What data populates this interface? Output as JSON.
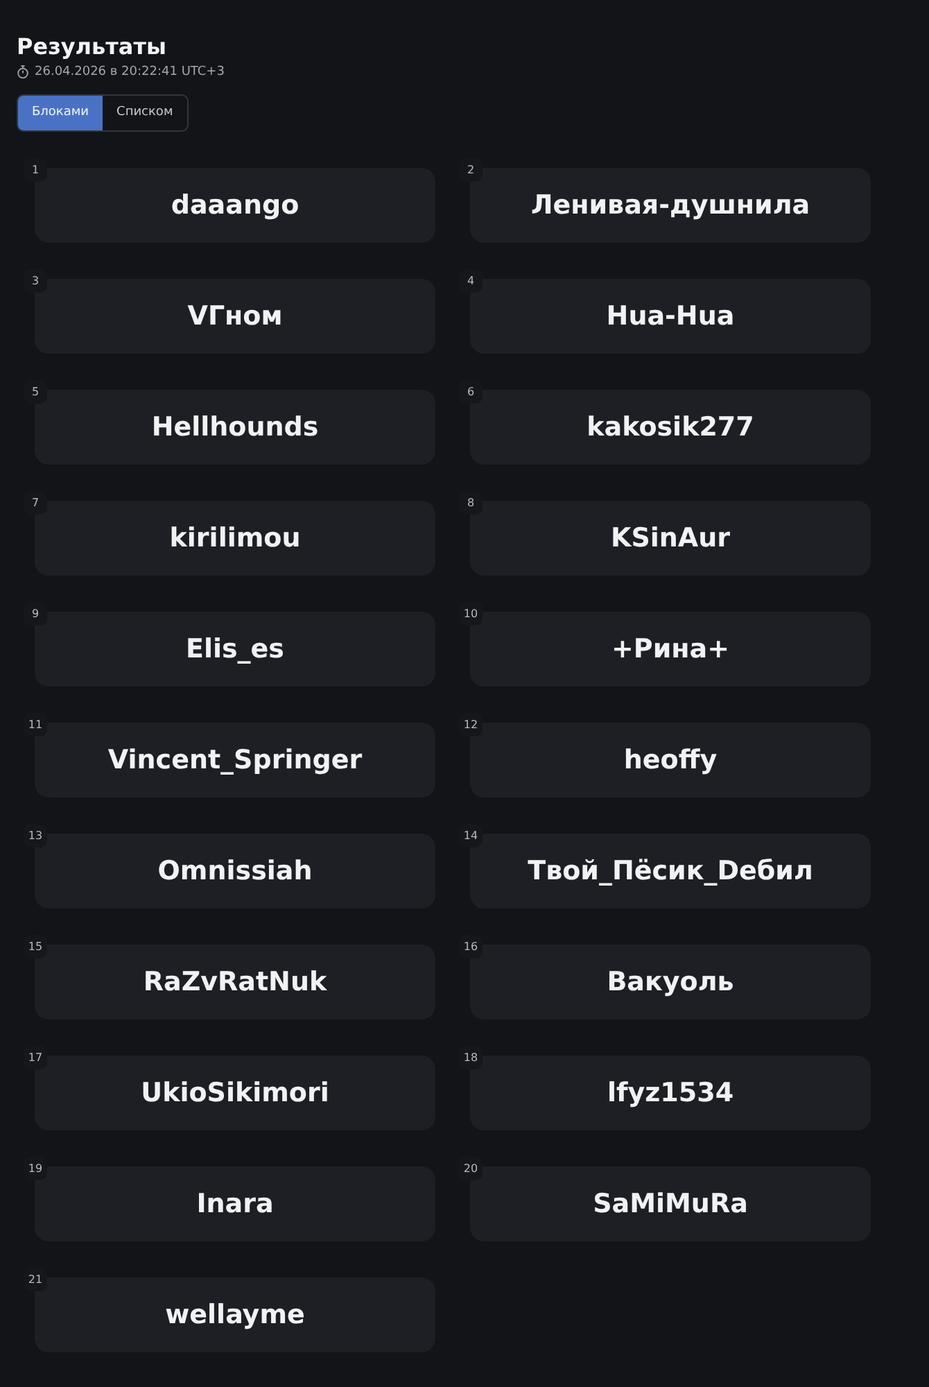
{
  "title": "Результаты",
  "timestamp": "26.04.2026 в 20:22:41 UTC+3",
  "view_toggle": [
    {
      "label": "Блоками",
      "selected": true
    },
    {
      "label": "Списком",
      "selected": false
    }
  ],
  "results": [
    {
      "rank": "1",
      "name": "daaango"
    },
    {
      "rank": "2",
      "name": "Ленивая-душнила"
    },
    {
      "rank": "3",
      "name": "VГном"
    },
    {
      "rank": "4",
      "name": "Hua-Hua"
    },
    {
      "rank": "5",
      "name": "Hellhounds"
    },
    {
      "rank": "6",
      "name": "kakosik277"
    },
    {
      "rank": "7",
      "name": "kirilimou"
    },
    {
      "rank": "8",
      "name": "KSinAur"
    },
    {
      "rank": "9",
      "name": "Elis_es"
    },
    {
      "rank": "10",
      "name": "+Рина+"
    },
    {
      "rank": "11",
      "name": "Vincent_Springer"
    },
    {
      "rank": "12",
      "name": "heoffy"
    },
    {
      "rank": "13",
      "name": "Omnissiah"
    },
    {
      "rank": "14",
      "name": "Твой_Пёсик_Dебил"
    },
    {
      "rank": "15",
      "name": "RaZvRatNuk"
    },
    {
      "rank": "16",
      "name": "Вакуоль"
    },
    {
      "rank": "17",
      "name": "UkioSikimori"
    },
    {
      "rank": "18",
      "name": "lfyz1534"
    },
    {
      "rank": "19",
      "name": "Inara"
    },
    {
      "rank": "20",
      "name": "SaMiMuRa"
    },
    {
      "rank": "21",
      "name": "wellayme"
    }
  ]
}
